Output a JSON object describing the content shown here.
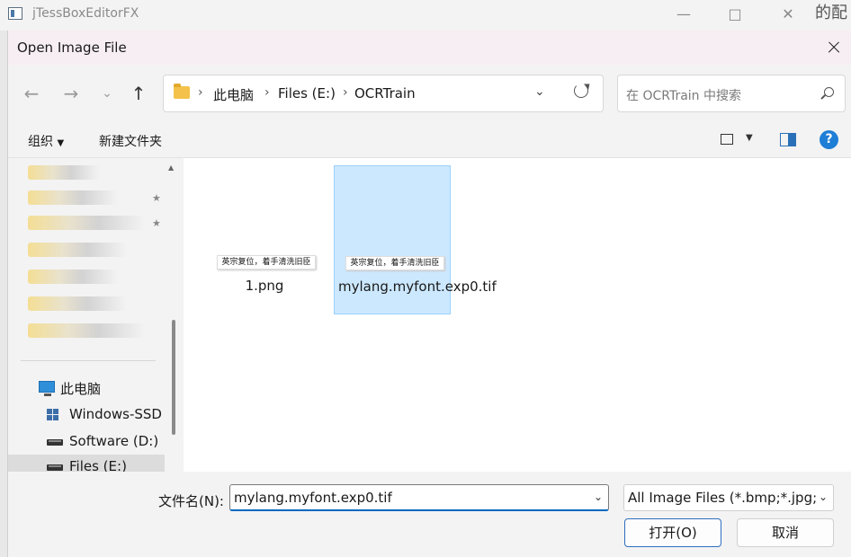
{
  "background_app": {
    "title": "jTessBoxEditorFX",
    "right_text": "的配"
  },
  "dialog": {
    "title": "Open Image File",
    "breadcrumbs": [
      "此电脑",
      "Files (E:)",
      "OCRTrain"
    ],
    "search_placeholder": "在 OCRTrain 中搜索",
    "toolbar": {
      "organize": "组织",
      "new_folder": "新建文件夹",
      "help": "?"
    },
    "nav_tree": [
      {
        "label": "此电脑",
        "icon": "computer-icon"
      },
      {
        "label": "Windows-SSD",
        "icon": "windows-drive-icon"
      },
      {
        "label": "Software (D:)",
        "icon": "drive-icon"
      },
      {
        "label": "Files (E:)",
        "icon": "drive-icon",
        "selected": true
      }
    ],
    "files": [
      {
        "name": "1.png",
        "thumb_text": "英宗复位，着手清洗旧臣",
        "selected": false
      },
      {
        "name": "mylang.myfont.exp0.tif",
        "thumb_text": "英宗复位，着手清洗旧臣",
        "selected": true
      }
    ],
    "footer": {
      "filename_label": "文件名(N):",
      "filename_value": "mylang.myfont.exp0.tif",
      "filter_value": "All Image Files (*.bmp;*.jpg;*",
      "open_label": "打开(O)",
      "cancel_label": "取消"
    }
  },
  "colors": {
    "accent": "#0067c0",
    "selection": "#cce8ff",
    "title_bar": "#f7eef3"
  }
}
